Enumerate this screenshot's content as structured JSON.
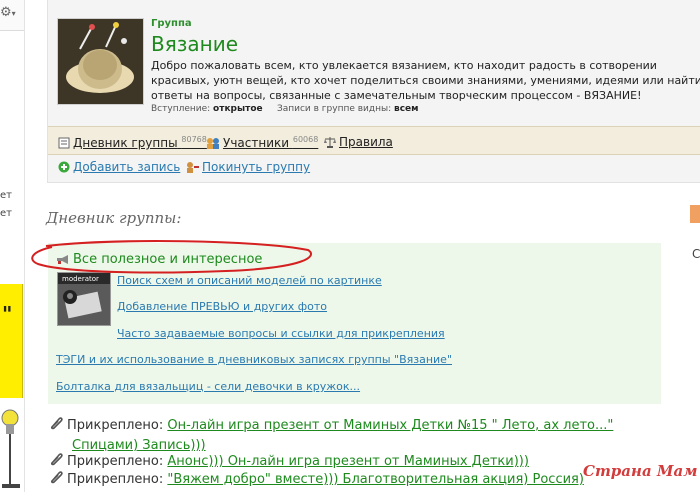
{
  "group": {
    "kicker": "Группа",
    "name": "Вязание",
    "description": "Добро пожаловать всем, кто увлекается вязанием, кто находит радость в сотворении красивых, уютн вещей, кто хочет поделиться своими знаниями, умениями, идеями или найти ответы на вопросы, связанные с замечательным творческим процессом - ВЯЗАНИЕ!",
    "join_label": "Вступление:",
    "join_value": "открытое",
    "visibility_label": "Записи в группе видны:",
    "visibility_value": "всем"
  },
  "tabs": [
    {
      "label": "Дневник группы",
      "count": "80768"
    },
    {
      "label": "Участники",
      "count": "60068"
    },
    {
      "label": "Правила",
      "count": ""
    }
  ],
  "actions": {
    "add_post": "Добавить запись",
    "leave_group": "Покинуть группу"
  },
  "diary": {
    "title": "Дневник группы:",
    "pinned_block": {
      "title": "Все полезное и интересное",
      "moderator_label": "moderator",
      "links": [
        "Поиск схем и описаний моделей по картинке",
        "Добавление ПРЕВЬЮ и других фото",
        "Часто задаваемые вопросы и ссылки для прикрепления",
        "ТЭГИ и их использование в дневниковых записях группы \"Вязание\"",
        "Болталка для вязальщиц - сели девочки в кружок..."
      ]
    },
    "pinned_posts": [
      {
        "label": "Прикреплено:",
        "title_line1": "Он-лайн игра презент от Маминых Детки №15 \" Лето, ах лето...\"",
        "title_line2": "Спицами) Запись)))"
      },
      {
        "label": "Прикреплено:",
        "title_line1": "Анонс))) Он-лайн игра презент от Маминых Детки)))",
        "title_line2": ""
      },
      {
        "label": "Прикреплено:",
        "title_line1": "\"Вяжем добро\" вместе))) Благотворительная акция) Россия)",
        "title_line2": ""
      }
    ]
  },
  "left_strip": {
    "text": "ет\nет",
    "quote": "\""
  },
  "right_edge": {
    "letter": "С"
  },
  "watermark": "Страна Мам",
  "colors": {
    "accent_green": "#1e8a1e",
    "link_blue": "#2a7ab0",
    "panel_green": "#eef8ea",
    "tab_bar": "#f2eddc",
    "annotation_red": "#d42020"
  },
  "icons": [
    "gear-icon",
    "diary-icon",
    "members-icon",
    "rules-icon",
    "plus-icon",
    "leave-icon",
    "megaphone-icon",
    "paperclip-icon"
  ]
}
